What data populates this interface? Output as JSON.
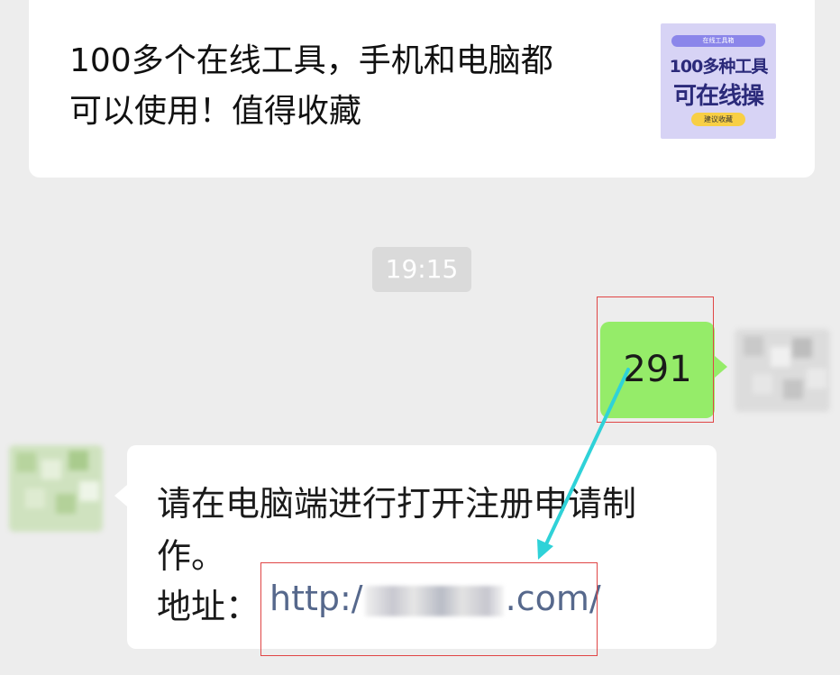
{
  "article_card": {
    "line1": "100多个在线工具，手机和电脑都",
    "line2": "可以使用！值得收藏",
    "thumbnail": {
      "top_tag": "在线工具箱",
      "line1": "100多种工具",
      "line2": "可在线操",
      "button": "建议收藏"
    }
  },
  "timestamp": "19:15",
  "sent_message": {
    "text": "291"
  },
  "received_message": {
    "line1": "请在电脑端进行打开注册申请制",
    "line2": "作。",
    "address_label": "地址：",
    "url_prefix": "http:/",
    "url_suffix": ".com/"
  },
  "colors": {
    "background": "#ededed",
    "sent_bubble": "#95ec69",
    "received_bubble": "#ffffff",
    "link": "#56688c",
    "annotation_red": "#e04545",
    "annotation_arrow": "#2fd2d8"
  }
}
